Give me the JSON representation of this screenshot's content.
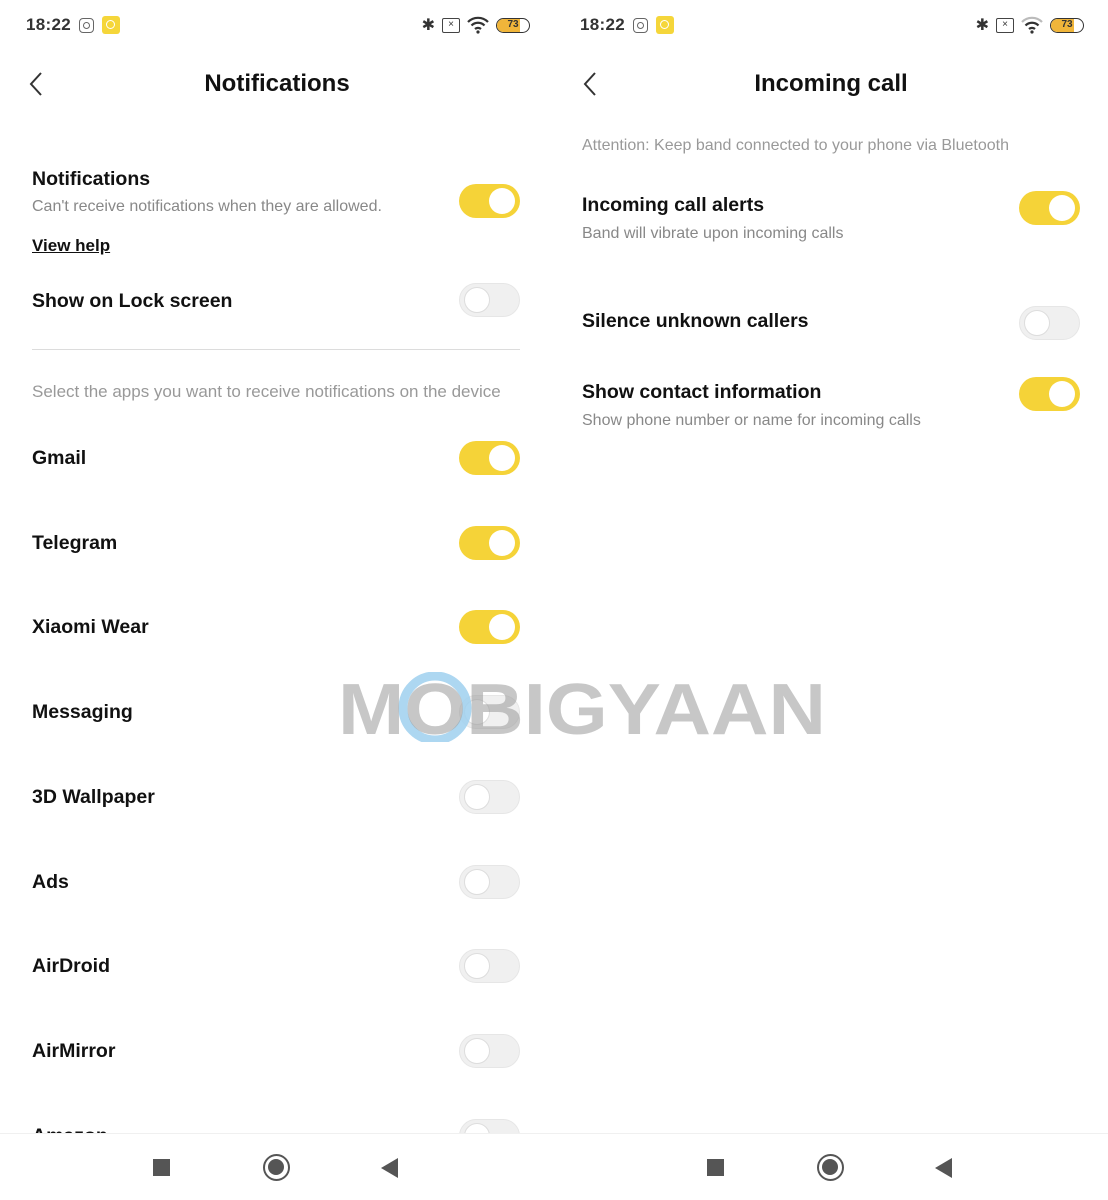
{
  "status_bar": {
    "time": "18:22",
    "battery_level": "73",
    "battery_percent": 73,
    "icons": [
      "instagram-icon",
      "app-notification-icon",
      "bluetooth-icon",
      "no-sim-icon",
      "wifi-icon",
      "battery-icon"
    ]
  },
  "colors": {
    "accent": "#F5D338",
    "toggle_off": "#F0F0F0"
  },
  "left": {
    "title": "Notifications",
    "main": {
      "label": "Notifications",
      "sub": "Can't receive notifications when they are allowed.",
      "on": true
    },
    "help_link": "View help",
    "lock": {
      "label": "Show on Lock screen",
      "on": false
    },
    "caption": "Select the apps you want to receive notifications on the device",
    "apps": [
      {
        "label": "Gmail",
        "on": true
      },
      {
        "label": "Telegram",
        "on": true
      },
      {
        "label": "Xiaomi Wear",
        "on": true
      },
      {
        "label": "Messaging",
        "on": false
      },
      {
        "label": "3D Wallpaper",
        "on": false
      },
      {
        "label": "Ads",
        "on": false
      },
      {
        "label": "AirDroid",
        "on": false
      },
      {
        "label": "AirMirror",
        "on": false
      },
      {
        "label": "Amazon",
        "on": false
      }
    ]
  },
  "right": {
    "title": "Incoming call",
    "attention": "Attention: Keep band connected to your phone via Bluetooth",
    "items": [
      {
        "label": "Incoming call alerts",
        "sub": "Band will vibrate upon incoming calls",
        "on": true
      },
      {
        "label": "Silence unknown callers",
        "sub": "",
        "on": false
      },
      {
        "label": "Show contact information",
        "sub": "Show phone number or name for incoming calls",
        "on": true
      }
    ]
  },
  "watermark": "MOBIGYAAN"
}
